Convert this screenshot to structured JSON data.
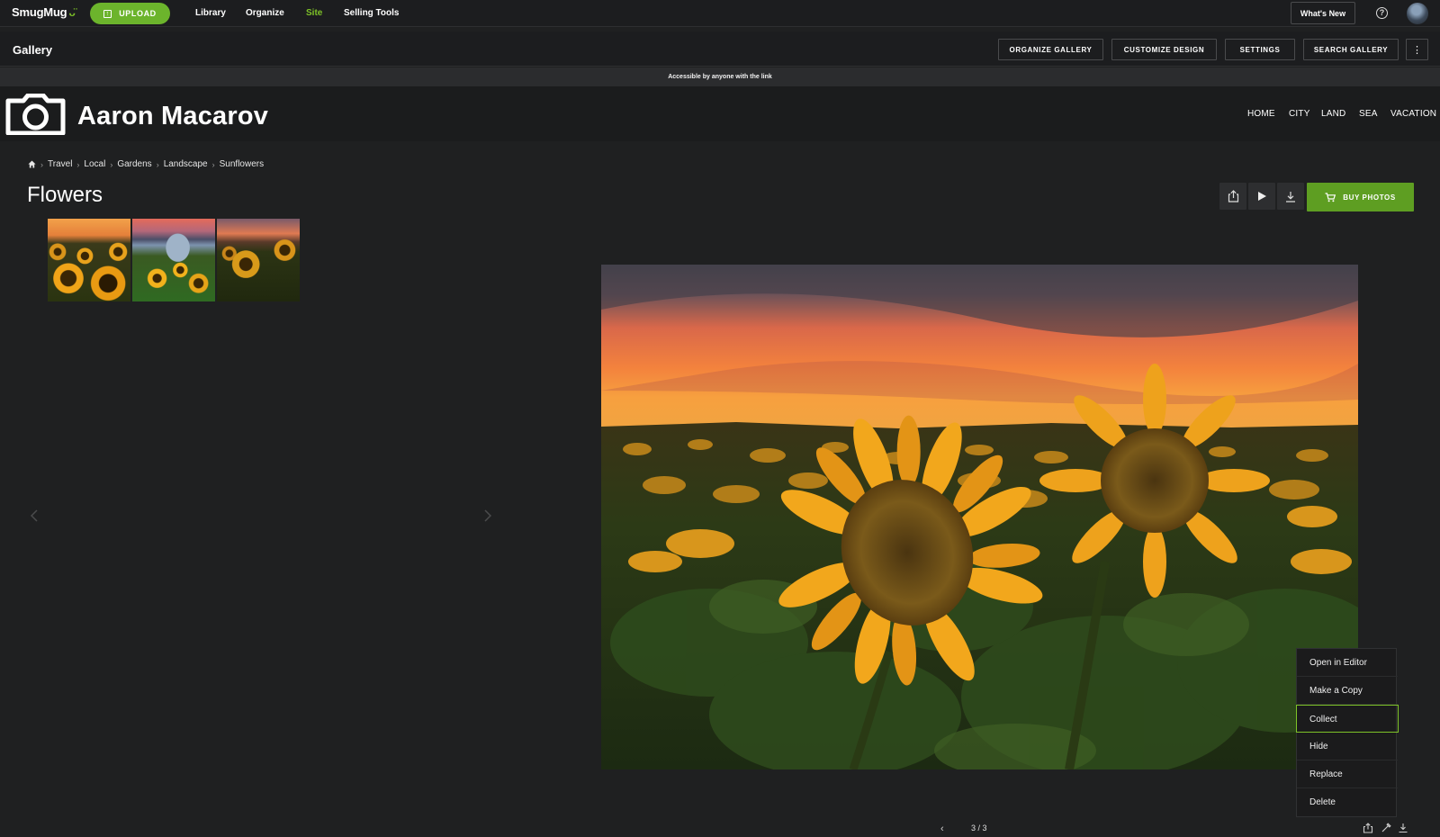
{
  "topbar": {
    "logo": "SmugMug",
    "upload_label": "UPLOAD",
    "nav": [
      "Library",
      "Organize",
      "Site",
      "Selling Tools"
    ],
    "active_nav": "Site",
    "whats_new": "What's New",
    "help_glyph": "?"
  },
  "gallerybar": {
    "title": "Gallery",
    "buttons": [
      "ORGANIZE GALLERY",
      "CUSTOMIZE DESIGN",
      "SETTINGS",
      "SEARCH GALLERY"
    ],
    "more_glyph": "⋮"
  },
  "access_notice": "Accessible by anyone with the link",
  "site": {
    "name": "Aaron Macarov",
    "nav": [
      "HOME",
      "CITY",
      "LAND",
      "SEA",
      "VACATION"
    ]
  },
  "breadcrumb": [
    "Travel",
    "Local",
    "Gardens",
    "Landscape",
    "Sunflowers"
  ],
  "page_title": "Flowers",
  "buy_photos": "BUY PHOTOS",
  "context_menu": {
    "items": [
      "Open in Editor",
      "Make a Copy",
      "Collect",
      "Hide",
      "Replace",
      "Delete"
    ],
    "highlighted": "Collect"
  },
  "pager": {
    "text": "3 / 3"
  },
  "colors": {
    "brand_green": "#6cb42c",
    "buy_green": "#5e9e22",
    "highlight": "#7ec328",
    "background": "#1f2021"
  },
  "icons": [
    "upload-icon",
    "help-icon",
    "avatar",
    "camera-logo-icon",
    "home-icon",
    "share-icon",
    "play-icon",
    "download-icon",
    "cart-icon",
    "chevron-left-icon",
    "chevron-right-icon",
    "edit-icon"
  ]
}
